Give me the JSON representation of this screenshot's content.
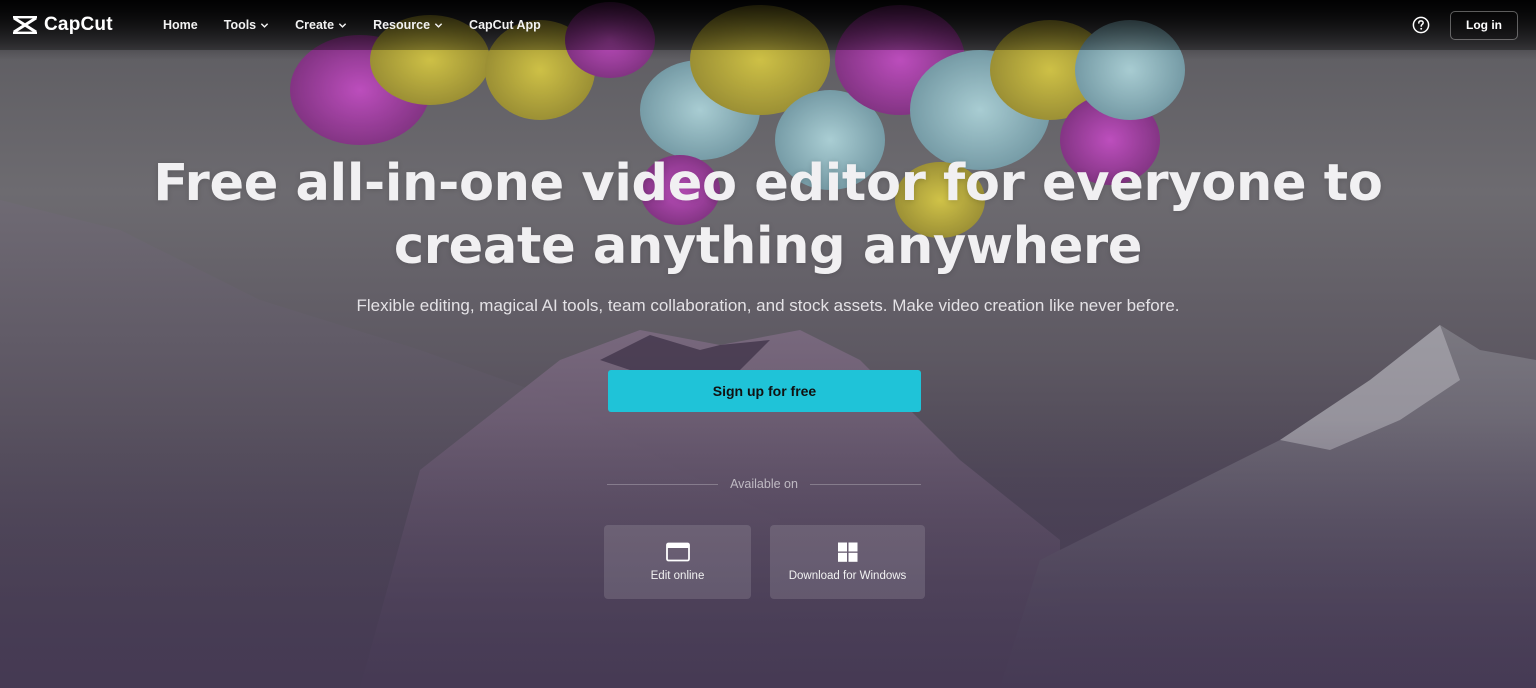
{
  "brand": {
    "name": "CapCut",
    "logo_icon": "capcut-logo-icon"
  },
  "nav": {
    "items": [
      {
        "label": "Home",
        "dropdown": false
      },
      {
        "label": "Tools",
        "dropdown": true
      },
      {
        "label": "Create",
        "dropdown": true
      },
      {
        "label": "Resource",
        "dropdown": true
      },
      {
        "label": "CapCut App",
        "dropdown": false
      }
    ],
    "help_icon": "question-circle-icon",
    "login_label": "Log in"
  },
  "hero": {
    "headline_line1": "Free all-in-one video editor for everyone to",
    "headline_line2": "create anything anywhere",
    "subheadline": "Flexible editing, magical AI tools, team collaboration, and stock assets. Make video creation like never before.",
    "cta_label": "Sign up for free",
    "available_label": "Available on",
    "platforms": [
      {
        "label": "Edit online",
        "icon": "browser-window-icon"
      },
      {
        "label": "Download for Windows",
        "icon": "windows-logo-icon"
      }
    ]
  },
  "colors": {
    "accent": "#1fc3d8",
    "nav_bg": "#0c0c0e",
    "scene_purple": "#4b4354"
  }
}
